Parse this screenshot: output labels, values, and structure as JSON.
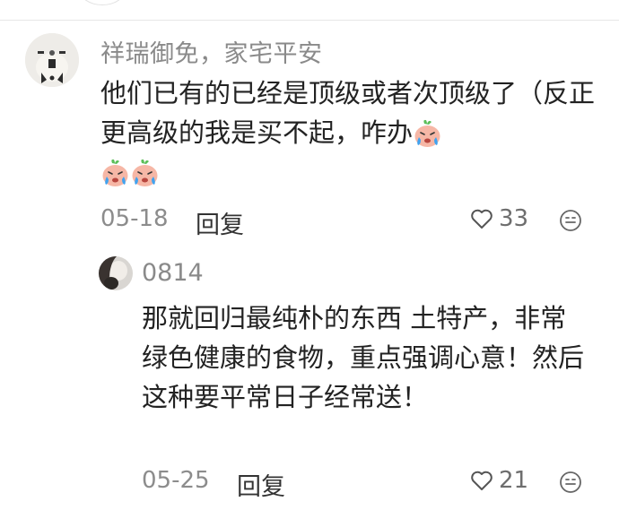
{
  "comment1": {
    "author": "祥瑞御免，家宅平安",
    "text": "他们已有的已经是顶级或者次顶级了（反正更高级的我是买不起，咋办",
    "emoji": "crying-emoji",
    "date": "05-18",
    "reply_label": "回复",
    "likes": "33"
  },
  "comment2": {
    "author": "0814",
    "text": "那就回归最纯朴的东西 土特产，非常绿色健康的食物，重点强调心意！然后这种要平常日子经常送！",
    "date": "05-25",
    "reply_label": "回复",
    "likes": "21"
  },
  "colors": {
    "meta_gray": "#8c8c8c",
    "text": "#222222",
    "divider": "#e6e6e6"
  }
}
